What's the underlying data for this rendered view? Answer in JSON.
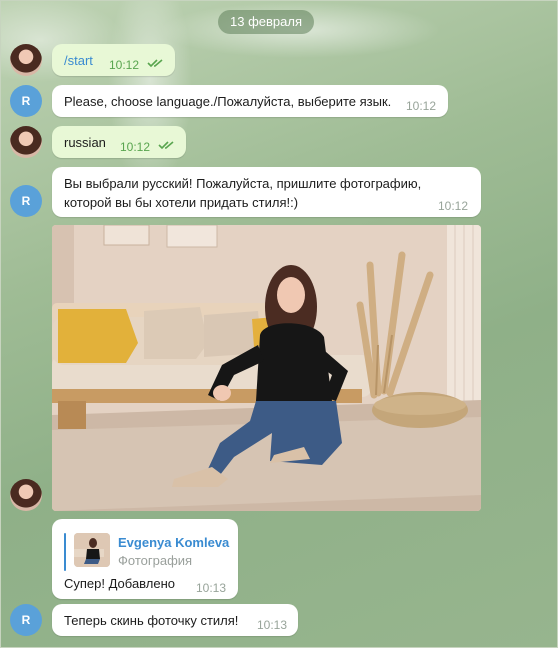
{
  "chat": {
    "date": "13 февраля",
    "bot_initial": "R",
    "messages": [
      {
        "direction": "out",
        "text": "/start",
        "time": "10:12",
        "status": "read"
      },
      {
        "direction": "in",
        "text": "Please, choose language./Пожалуйста, выберите язык.",
        "time": "10:12"
      },
      {
        "direction": "out",
        "text": "russian",
        "time": "10:12",
        "status": "read"
      },
      {
        "direction": "in",
        "lines": [
          "Вы выбрали русский! Пожалуйста, пришлите фотографию,",
          "которой вы бы хотели придать стиля!:)"
        ],
        "time": "10:12"
      },
      {
        "direction": "out",
        "type": "photo"
      },
      {
        "direction": "in",
        "reply": {
          "name": "Evgenya Komleva",
          "subtitle": "Фотография"
        },
        "text": "Супер! Добавлено",
        "time": "10:13"
      },
      {
        "direction": "in",
        "text": "Теперь скинь фоточку стиля!",
        "time": "10:13"
      }
    ]
  },
  "icons": {
    "read_ticks": "double-check-icon",
    "user_avatar": "user-avatar-photo",
    "bot_avatar": "bot-avatar-letter"
  },
  "colors": {
    "outgoing_bubble": "#e8f8d6",
    "incoming_bubble": "#ffffff",
    "accent": "#3a8bd1",
    "read_ticks": "#59a54f",
    "bot_avatar": "#5aa1d9"
  }
}
